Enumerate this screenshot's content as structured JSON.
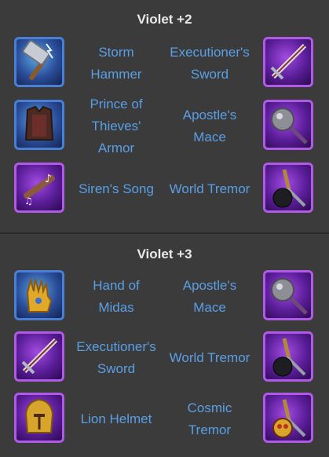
{
  "sections": [
    {
      "title": "Violet +2",
      "rows": [
        {
          "left": {
            "name": "Storm Hammer",
            "lines": [
              "Storm",
              "Hammer"
            ],
            "icon": "storm-hammer-icon"
          },
          "right": {
            "name": "Executioner's Sword",
            "lines": [
              "Executioner's",
              "Sword"
            ],
            "icon": "executioners-sword-icon"
          }
        },
        {
          "left": {
            "name": "Prince of Thieves' Armor",
            "lines": [
              "Prince of",
              "Thieves'",
              "Armor"
            ],
            "icon": "prince-of-thieves-armor-icon"
          },
          "right": {
            "name": "Apostle's Mace",
            "lines": [
              "Apostle's",
              "Mace"
            ],
            "icon": "apostles-mace-icon"
          }
        },
        {
          "left": {
            "name": "Siren's Song",
            "lines": [
              "Siren's Song"
            ],
            "icon": "sirens-song-icon"
          },
          "right": {
            "name": "World Tremor",
            "lines": [
              "World Tremor"
            ],
            "icon": "world-tremor-icon"
          }
        }
      ]
    },
    {
      "title": "Violet +3",
      "rows": [
        {
          "left": {
            "name": "Hand of Midas",
            "lines": [
              "Hand of",
              "Midas"
            ],
            "icon": "hand-of-midas-icon"
          },
          "right": {
            "name": "Apostle's Mace",
            "lines": [
              "Apostle's",
              "Mace"
            ],
            "icon": "apostles-mace-icon"
          }
        },
        {
          "left": {
            "name": "Executioner's Sword",
            "lines": [
              "Executioner's",
              "Sword"
            ],
            "icon": "executioners-sword-icon"
          },
          "right": {
            "name": "World Tremor",
            "lines": [
              "World Tremor"
            ],
            "icon": "world-tremor-icon"
          }
        },
        {
          "left": {
            "name": "Lion Helmet",
            "lines": [
              "Lion Helmet"
            ],
            "icon": "lion-helmet-icon"
          },
          "right": {
            "name": "Cosmic Tremor",
            "lines": [
              "Cosmic",
              "Tremor"
            ],
            "icon": "cosmic-tremor-icon"
          }
        }
      ]
    }
  ]
}
